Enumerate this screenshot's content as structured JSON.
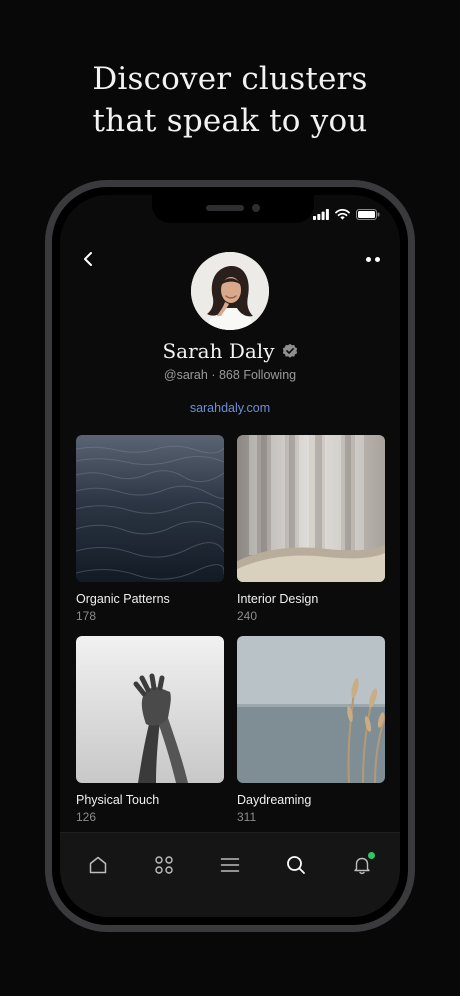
{
  "headline": {
    "line1": "Discover clusters",
    "line2": "that speak to you"
  },
  "status_bar": {
    "signal_icon": "signal-bars-icon",
    "wifi_icon": "wifi-icon",
    "battery_icon": "battery-icon"
  },
  "nav": {
    "back_icon": "chevron-left-icon",
    "more_icon": "more-dots-icon"
  },
  "profile": {
    "name": "Sarah Daly",
    "verified_icon": "verified-check-icon",
    "handle": "@sarah",
    "separator": "·",
    "following": "868 Following",
    "website": "sarahdaly.com"
  },
  "clusters": [
    {
      "title": "Organic Patterns",
      "count": "178"
    },
    {
      "title": "Interior Design",
      "count": "240"
    },
    {
      "title": "Physical Touch",
      "count": "126"
    },
    {
      "title": "Daydreaming",
      "count": "311"
    }
  ],
  "tabbar": {
    "items": [
      {
        "icon": "home-icon"
      },
      {
        "icon": "grid-dots-icon"
      },
      {
        "icon": "menu-lines-icon"
      },
      {
        "icon": "search-icon",
        "active": true
      },
      {
        "icon": "bell-icon",
        "badge": true
      }
    ]
  },
  "colors": {
    "background": "#080808",
    "link": "#6f8fd6",
    "notification_dot": "#30c85e",
    "muted_text": "#8c8c8c"
  }
}
